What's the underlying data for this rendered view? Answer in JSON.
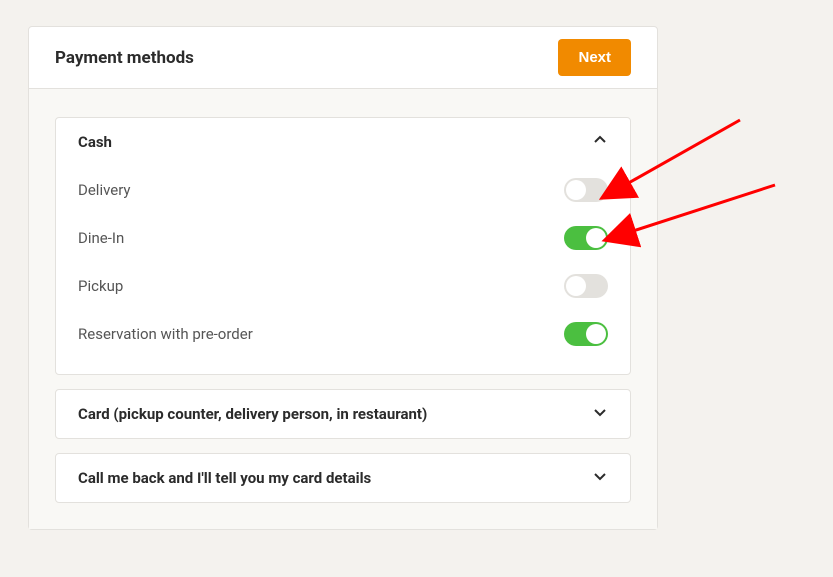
{
  "header": {
    "title": "Payment methods",
    "next_label": "Next"
  },
  "accordion": {
    "items": [
      {
        "label": "Cash",
        "expanded": true,
        "toggles": [
          {
            "label": "Delivery",
            "on": false
          },
          {
            "label": "Dine-In",
            "on": true
          },
          {
            "label": "Pickup",
            "on": false
          },
          {
            "label": "Reservation with pre-order",
            "on": true
          }
        ]
      },
      {
        "label": "Card (pickup counter, delivery person, in restaurant)",
        "expanded": false
      },
      {
        "label": "Call me back and I'll tell you my card details",
        "expanded": false
      }
    ]
  },
  "annotations": {
    "arrows": [
      {
        "target": "delivery-toggle"
      },
      {
        "target": "dinein-toggle"
      }
    ],
    "arrow_color": "#ff0000"
  }
}
